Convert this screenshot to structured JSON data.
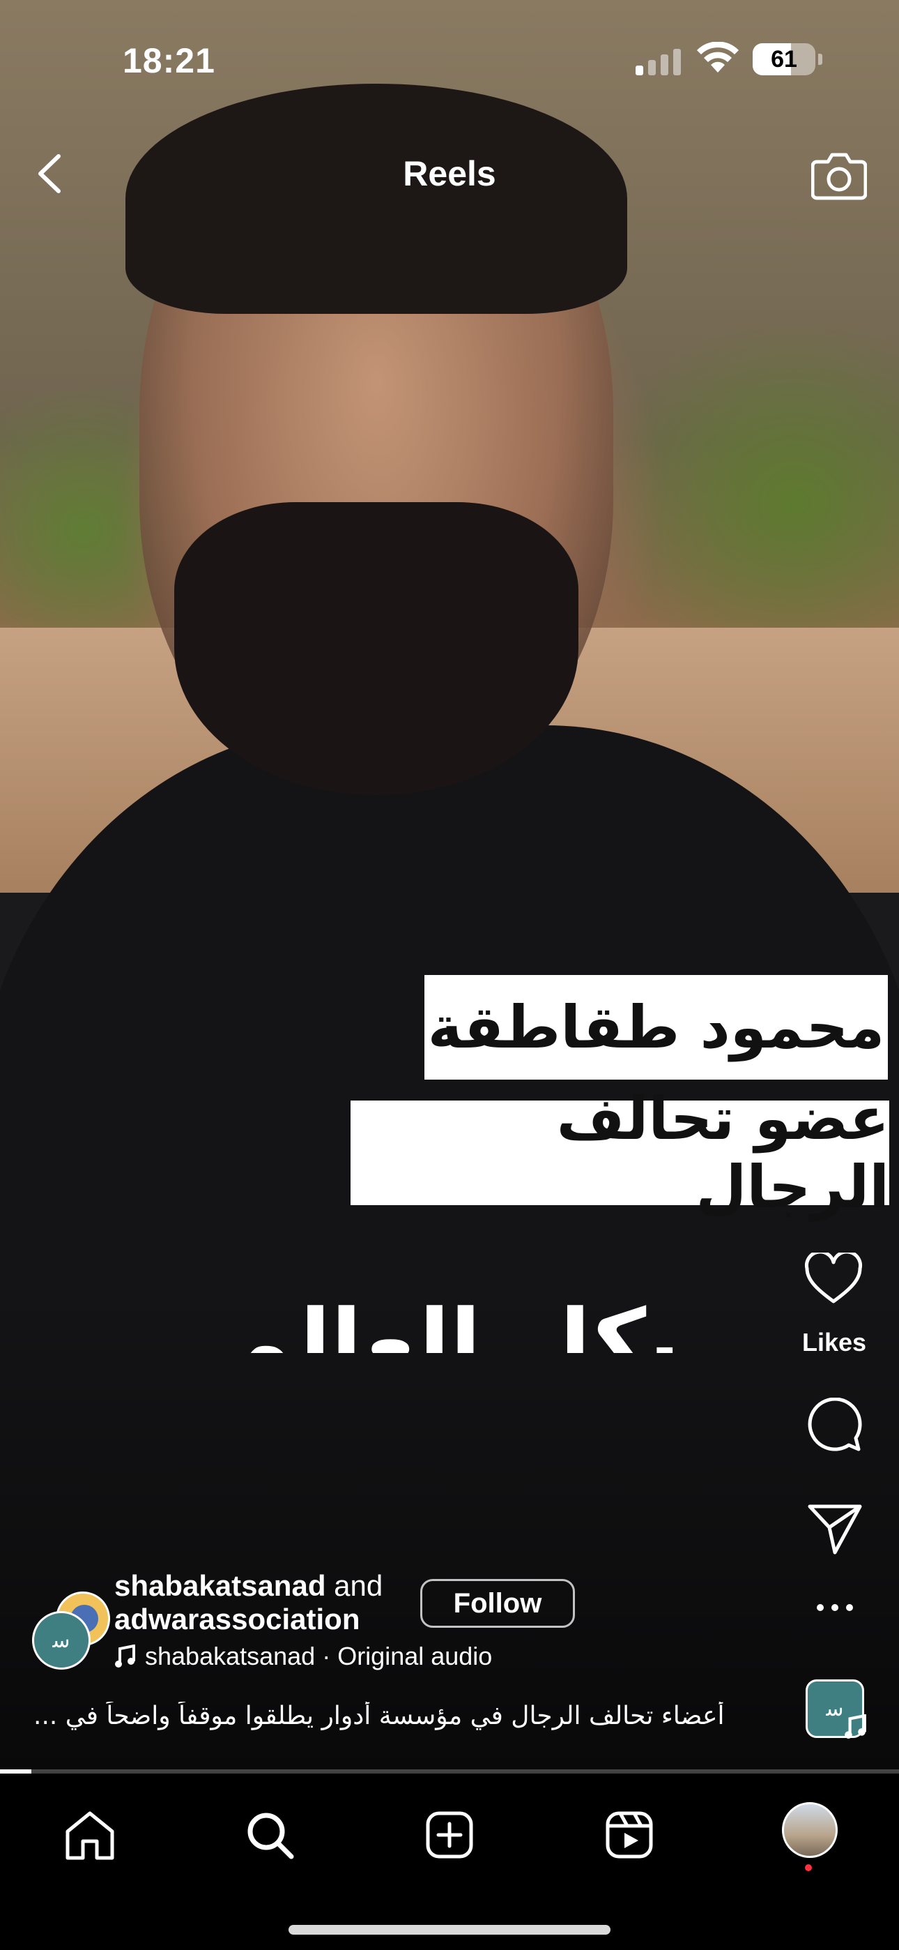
{
  "status_bar": {
    "time": "18:21",
    "battery": "61",
    "battery_level": 0.61
  },
  "header": {
    "title": "Reels"
  },
  "video": {
    "caption_line1": "محمود طقاطقة",
    "caption_line2": "عضو تحالف الرجال",
    "partial_text": "بكل العالم"
  },
  "actions": {
    "likes_label": "Likes",
    "more_label": "..."
  },
  "post": {
    "user1": "shabakatsanad",
    "and": "and",
    "user2": "adwarassociation",
    "follow_label": "Follow",
    "audio": "shabakatsanad · Original audio",
    "description": "أعضاء تحالف الرجال في مؤسسة أدوار يطلقوا موقفاً واضحاً في ..."
  },
  "playback": {
    "progress": 0.035
  },
  "tabbar": {
    "items": [
      "home",
      "search",
      "create",
      "reels",
      "profile"
    ]
  },
  "icons": [
    "back-icon",
    "camera-icon",
    "heart-icon",
    "comment-icon",
    "share-icon",
    "more-icon",
    "music-note-icon",
    "home-icon",
    "search-icon",
    "create-icon",
    "reels-icon"
  ]
}
